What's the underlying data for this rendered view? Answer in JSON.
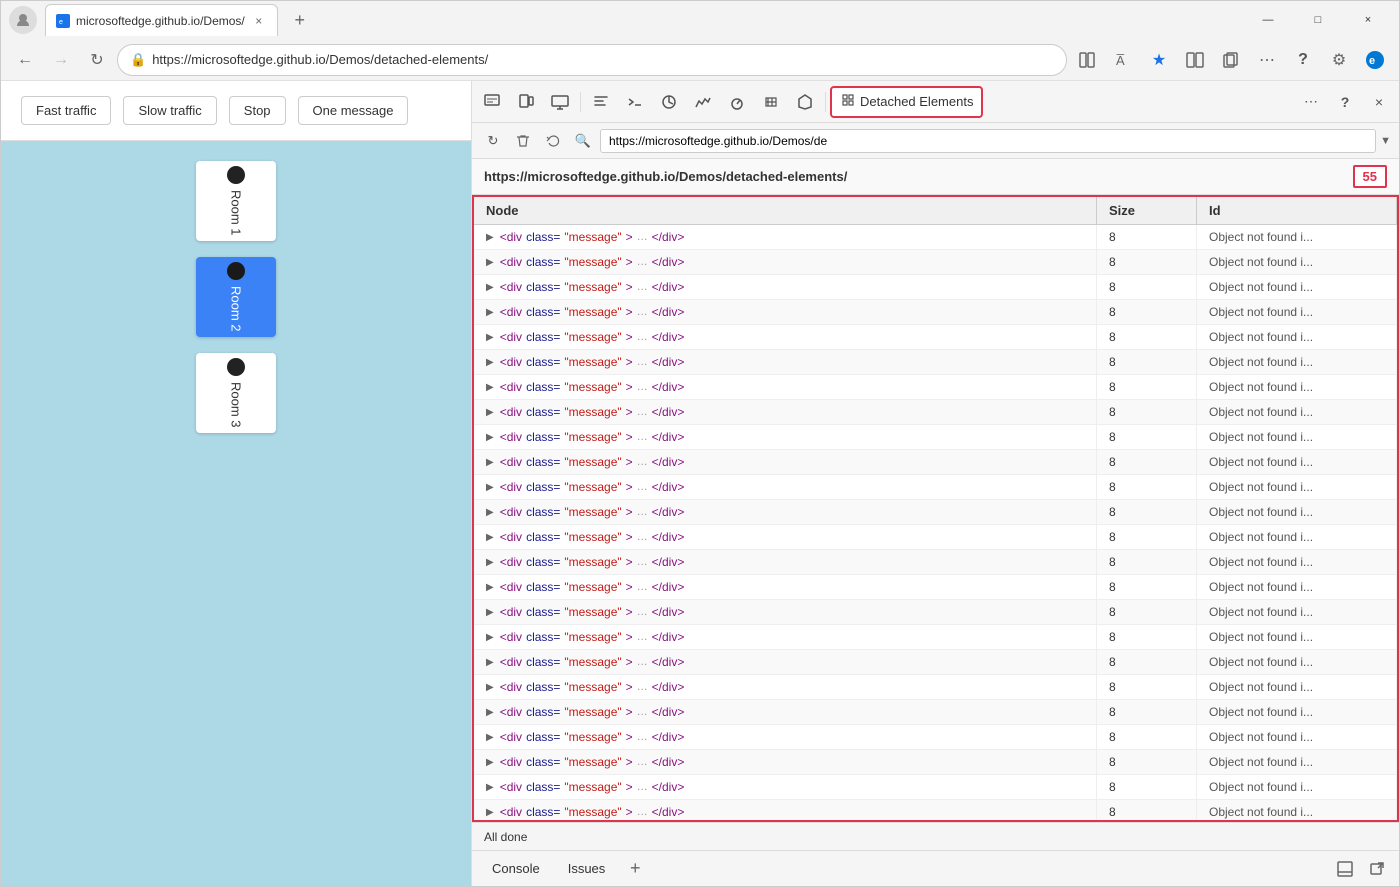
{
  "browser": {
    "tab_url": "microsoftedge.github.io/Demos/",
    "tab_close": "×",
    "tab_add": "+",
    "address": "https://microsoftedge.github.io/Demos/detached-elements/",
    "win_minimize": "—",
    "win_maximize": "□",
    "win_close": "×"
  },
  "demo": {
    "btn_fast": "Fast traffic",
    "btn_slow": "Slow traffic",
    "btn_stop": "Stop",
    "btn_one": "One message",
    "rooms": [
      {
        "label": "Room 1",
        "active": false
      },
      {
        "label": "Room 2",
        "active": true
      },
      {
        "label": "Room 3",
        "active": false
      }
    ]
  },
  "devtools": {
    "panel_name": "Detached Elements",
    "url_bar": "https://microsoftedge.github.io/Demos/de",
    "panel_url": "https://microsoftedge.github.io/Demos/detached-elements/",
    "count": "55",
    "col_node": "Node",
    "col_size": "Size",
    "col_id": "Id",
    "node_template": "<div class=\"message\"> … </div>",
    "node_size": "8",
    "node_id": "Object not found i...",
    "row_count": 24,
    "status": "All done"
  },
  "bottom_bar": {
    "tab_console": "Console",
    "tab_issues": "Issues",
    "tab_add": "+"
  }
}
